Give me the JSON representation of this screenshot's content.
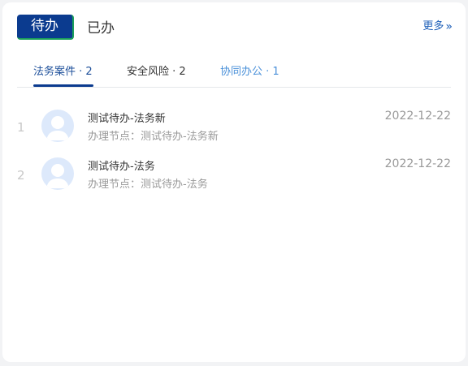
{
  "header": {
    "tabs": [
      {
        "label": "待办",
        "active": true
      },
      {
        "label": "已办",
        "active": false
      }
    ],
    "more_label": "更多",
    "more_icon": "double-chevron-right-icon"
  },
  "sub_tabs": [
    {
      "label": "法务案件 · 2",
      "active": true
    },
    {
      "label": "安全风险 · 2",
      "active": false
    },
    {
      "label": "协同办公 · 1",
      "active": false
    }
  ],
  "items": [
    {
      "index": "1",
      "title": "测试待办-法务新",
      "subtitle": "办理节点：测试待办-法务新",
      "date": "2022-12-22"
    },
    {
      "index": "2",
      "title": "测试待办-法务",
      "subtitle": "办理节点：测试待办-法务",
      "date": "2022-12-22"
    }
  ],
  "colors": {
    "accent": "#0b3b8f",
    "accent_border": "#1aa05a",
    "link": "#1d5fb8",
    "avatar_bg": "#dde9fb"
  }
}
